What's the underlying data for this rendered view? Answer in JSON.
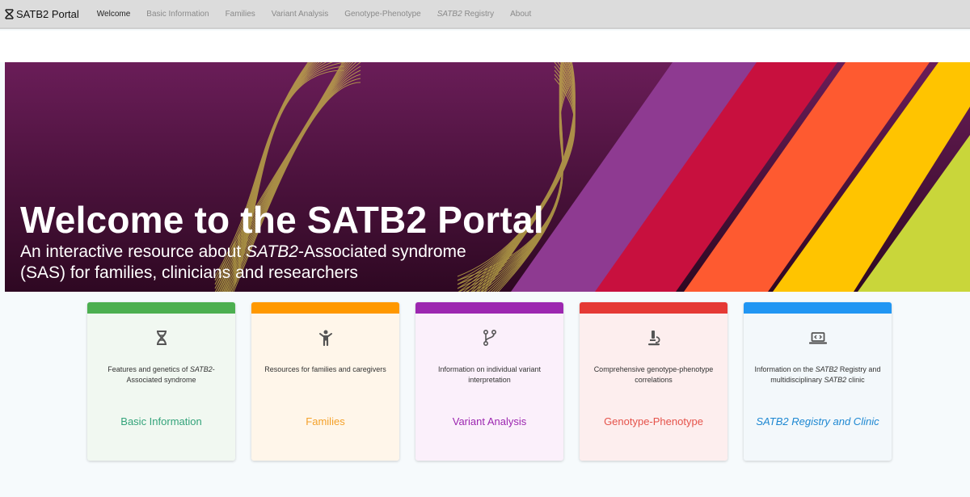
{
  "nav": {
    "brand": "SATB2 Portal",
    "items": [
      {
        "label": "Welcome",
        "active": true
      },
      {
        "label": "Basic Information"
      },
      {
        "label": "Families"
      },
      {
        "label": "Variant Analysis"
      },
      {
        "label": "Genotype-Phenotype"
      },
      {
        "label": "Registry",
        "em": "SATB2"
      },
      {
        "label": "About"
      }
    ]
  },
  "hero": {
    "title": "Welcome to the SATB2 Portal",
    "subtitle_pre": "An interactive resource about ",
    "subtitle_em": "SATB2",
    "subtitle_post": "-Associated syndrome (SAS) for families, clinicians and researchers"
  },
  "colors": {
    "hero_bg": "#4a1040",
    "stripes": [
      "#8e3a91",
      "#c8103e",
      "#fe5a30",
      "#ffc400",
      "#c9d63a"
    ]
  },
  "cards": [
    {
      "icon": "dna-icon",
      "bar": "#4caf50",
      "bg": "#f1f8f1",
      "link_color": "#33a37a",
      "desc_pre": "Features and genetics of ",
      "desc_em": "SATB2",
      "desc_post": "-Associated syndrome",
      "link": "Basic Information"
    },
    {
      "icon": "person-icon",
      "bar": "#ff9800",
      "bg": "#fff6ea",
      "link_color": "#f4a12a",
      "desc_pre": "Resources for families and caregivers",
      "desc_em": "",
      "desc_post": "",
      "link": "Families"
    },
    {
      "icon": "branch-icon",
      "bar": "#9c27b0",
      "bg": "#fbf0fb",
      "link_color": "#9c27b0",
      "desc_pre": "Information on individual variant interpretation",
      "desc_em": "",
      "desc_post": "",
      "link": "Variant Analysis"
    },
    {
      "icon": "microscope-icon",
      "bar": "#e53935",
      "bg": "#fdeeee",
      "link_color": "#e5534b",
      "desc_pre": "Comprehensive genotype-phenotype correlations",
      "desc_em": "",
      "desc_post": "",
      "link": "Genotype-Phenotype"
    },
    {
      "icon": "laptop-code-icon",
      "bar": "#2196f3",
      "bg": "#f3f8fb",
      "link_color": "#1e88d2",
      "desc_pre": "Information on the ",
      "desc_em": "SATB2",
      "desc_post": " Registry and multidisciplinary ",
      "desc_em2": "SATB2",
      "desc_post2": " clinic",
      "link_em": "SATB2",
      "link": " Registry and Clinic"
    }
  ]
}
